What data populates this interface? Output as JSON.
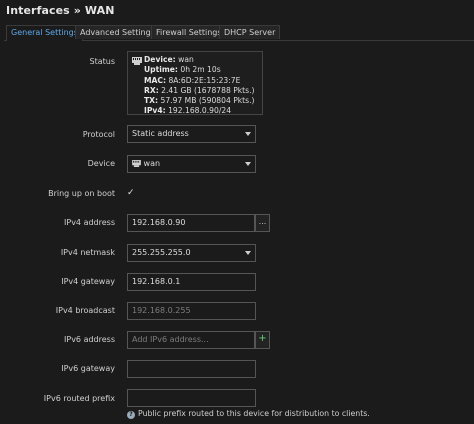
{
  "page": {
    "title": "Interfaces » WAN"
  },
  "tabs": [
    {
      "label": "General Settings"
    },
    {
      "label": "Advanced Settings"
    },
    {
      "label": "Firewall Settings"
    },
    {
      "label": "DHCP Server"
    }
  ],
  "status": {
    "label": "Status",
    "device_key": "Device:",
    "device_val": "wan",
    "uptime_key": "Uptime:",
    "uptime_val": "0h 2m 10s",
    "mac_key": "MAC:",
    "mac_val": "8A:6D:2E:15:23:7E",
    "rx_key": "RX:",
    "rx_val": "2.41 GB (1678788 Pkts.)",
    "tx_key": "TX:",
    "tx_val": "57.97 MB (590804 Pkts.)",
    "ipv4_key": "IPv4:",
    "ipv4_val": "192.168.0.90/24"
  },
  "form": {
    "protocol": {
      "label": "Protocol",
      "value": "Static address"
    },
    "device": {
      "label": "Device",
      "value": "wan"
    },
    "boot": {
      "label": "Bring up on boot",
      "mark": "✓"
    },
    "ipv4_address": {
      "label": "IPv4 address",
      "value": "192.168.0.90",
      "button": "..."
    },
    "ipv4_netmask": {
      "label": "IPv4 netmask",
      "value": "255.255.255.0"
    },
    "ipv4_gateway": {
      "label": "IPv4 gateway",
      "value": "192.168.0.1"
    },
    "ipv4_broadcast": {
      "label": "IPv4 broadcast",
      "placeholder": "192.168.0.255"
    },
    "ipv6_address": {
      "label": "IPv6 address",
      "placeholder": "Add IPv6 address...",
      "button": "+"
    },
    "ipv6_gateway": {
      "label": "IPv6 gateway",
      "value": ""
    },
    "ipv6_prefix": {
      "label": "IPv6 routed prefix",
      "value": ""
    },
    "hint": "Public prefix routed to this device for distribution to clients.",
    "hint_icon": "?"
  },
  "colors": {
    "accent": "#5fa8e8",
    "plus_button": "#5fd07a"
  }
}
